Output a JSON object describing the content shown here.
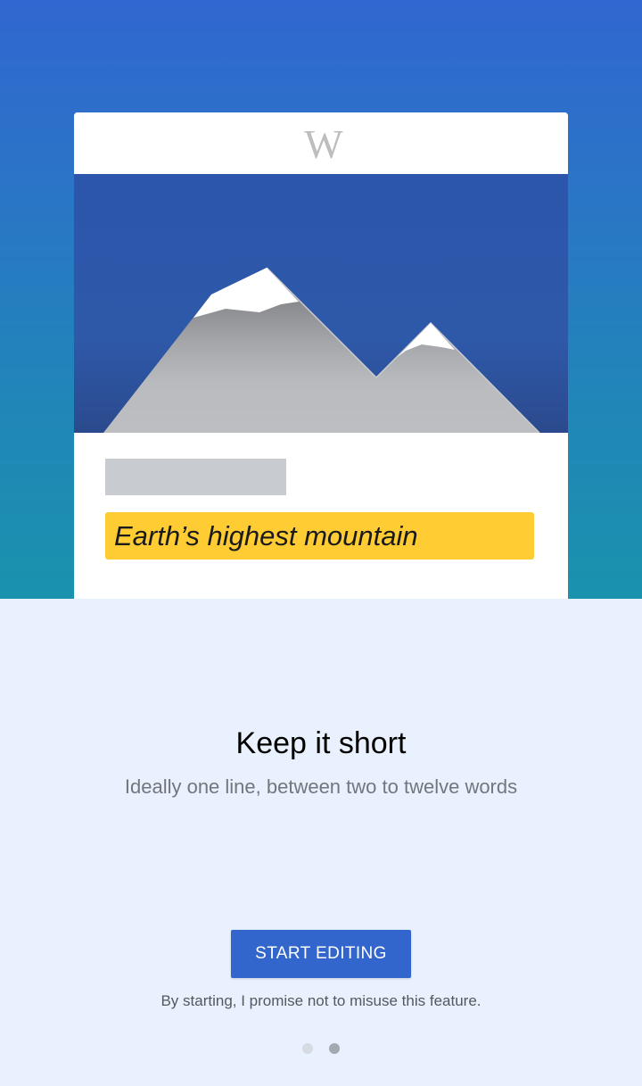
{
  "onboarding": {
    "logo_text": "W",
    "description_example": "Earth’s highest mountain",
    "title": "Keep it short",
    "subtitle": "Ideally one line, between two to twelve words",
    "start_button_label": "START EDITING",
    "disclaimer": "By starting, I promise not to misuse this feature.",
    "pager": {
      "total_pages": 2,
      "current_page": 2
    }
  },
  "colors": {
    "accent": "#3366cc",
    "highlight": "#ffcc33",
    "background": "#eaf1fe",
    "hero_top": "#3067d0",
    "hero_bottom": "#1a92ad"
  },
  "icons": {
    "logo": "wikipedia-w-logo",
    "illustration": "mountain-illustration"
  }
}
